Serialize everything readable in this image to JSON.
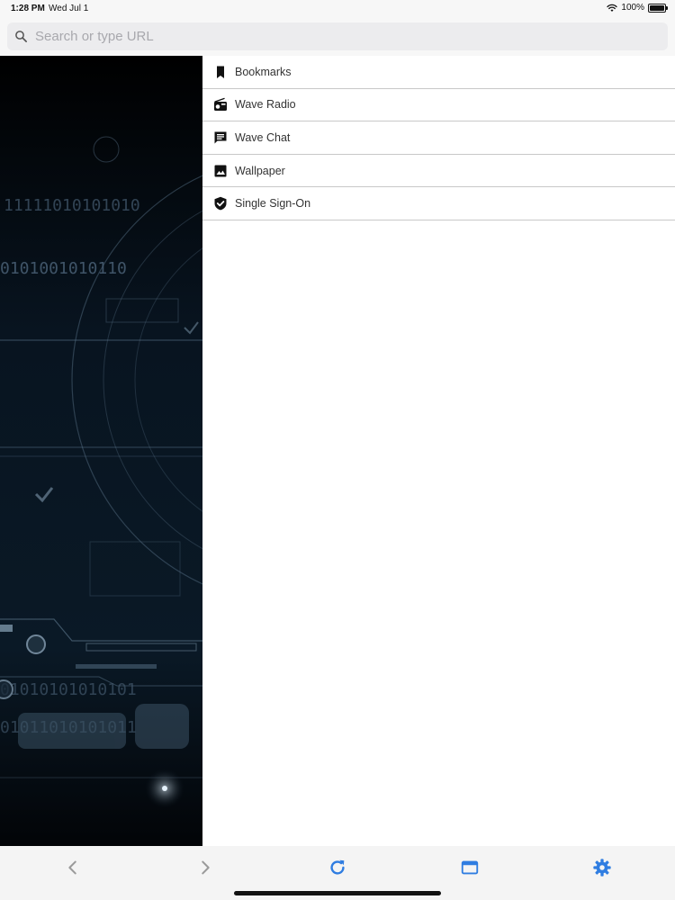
{
  "status_bar": {
    "time": "1:28 PM",
    "date": "Wed Jul 1",
    "battery_percent": "100%",
    "wifi_icon": "wifi-icon",
    "battery_icon": "battery-icon"
  },
  "search": {
    "placeholder": "Search or type URL",
    "value": "",
    "icon": "search-icon"
  },
  "menu": {
    "items": [
      {
        "label": "Bookmarks",
        "icon": "bookmark-icon"
      },
      {
        "label": "Wave Radio",
        "icon": "radio-icon"
      },
      {
        "label": "Wave Chat",
        "icon": "chat-icon"
      },
      {
        "label": "Wallpaper",
        "icon": "image-icon"
      },
      {
        "label": "Single Sign-On",
        "icon": "shield-check-icon"
      }
    ]
  },
  "toolbar": {
    "back_icon": "chevron-left-icon",
    "forward_icon": "chevron-right-icon",
    "reload_icon": "reload-icon",
    "tabs_icon": "tabs-icon",
    "settings_icon": "gear-icon"
  },
  "colors": {
    "accent": "#2f7de1",
    "disabled": "#9a9a9a",
    "wallpaper_bg": "#030608",
    "wallpaper_lines": "#5f7a90"
  }
}
